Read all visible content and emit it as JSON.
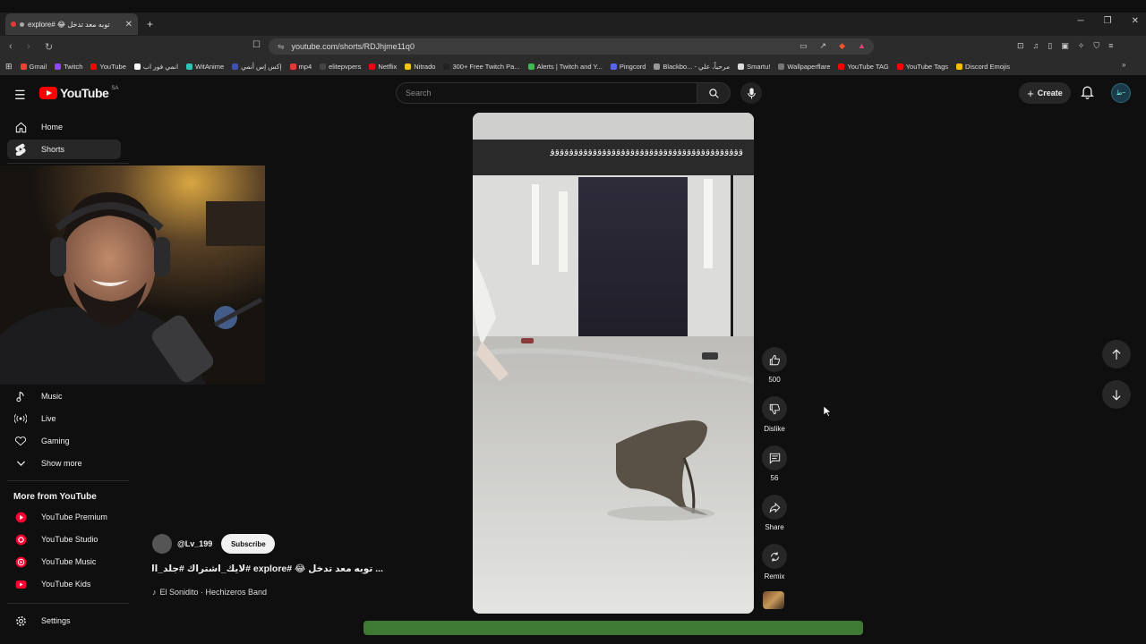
{
  "browser": {
    "tab_title": "explore# 😂 توبه معد تدخل",
    "url": "youtube.com/shorts/RDJhjme11q0",
    "bookmarks": [
      "Gmail",
      "Twitch",
      "YouTube",
      "انمي فور اب",
      "WitAnime",
      "إكس إس أنمي",
      "mp4",
      "elitepvpers",
      "Netflix",
      "Nitrado",
      "300+ Free Twitch Pa...",
      "Alerts | Twitch and Y...",
      "Pingcord",
      "Blackbo... - مرحباً، علي",
      "Smartu!",
      "Wallpaperflare",
      "YouTube TAG",
      "YouTube Tags",
      "Discord Emojis"
    ],
    "bookmark_colors": [
      "#ea4335",
      "#9146ff",
      "#ff0000",
      "#ffffff",
      "#2ec4b6",
      "#3f51b5",
      "#e53935",
      "#444444",
      "#e50914",
      "#f5c518",
      "#222222",
      "#3fb950",
      "#5865f2",
      "#999999",
      "#dddddd",
      "#777777",
      "#ff0000",
      "#ff0000",
      "#fbbc05"
    ]
  },
  "header": {
    "logo_text": "YouTube",
    "country_code": "SA",
    "search_placeholder": "Search",
    "create_label": "Create",
    "avatar_text": "ط~"
  },
  "sidebar": {
    "top_items": [
      {
        "label": "Home",
        "icon": "home-icon"
      },
      {
        "label": "Shorts",
        "icon": "shorts-icon",
        "active": true
      }
    ],
    "explore_items": [
      {
        "label": "Music",
        "icon": "music-note-icon"
      },
      {
        "label": "Live",
        "icon": "live-icon"
      },
      {
        "label": "Gaming",
        "icon": "gaming-icon"
      },
      {
        "label": "Show more",
        "icon": "chevron-down-icon"
      }
    ],
    "more_heading": "More from YouTube",
    "more_items": [
      {
        "label": "YouTube Premium",
        "icon": "youtube-premium-icon"
      },
      {
        "label": "YouTube Studio",
        "icon": "youtube-studio-icon"
      },
      {
        "label": "YouTube Music",
        "icon": "youtube-music-icon"
      },
      {
        "label": "YouTube Kids",
        "icon": "youtube-kids-icon"
      }
    ],
    "settings_label": "Settings"
  },
  "short": {
    "channel": "@Lv_199",
    "subscribe_label": "Subscribe",
    "title": "... توبه معد تدخل 😂 #explore #لايك_اشتراك #جلد_الدعم",
    "song": "El Sonidito · Hechizeros Band",
    "like_count": "500",
    "dislike_label": "Dislike",
    "comment_count": "56",
    "share_label": "Share",
    "remix_label": "Remix",
    "overlay_text": "ﻗﻗﻗﻗﻗﻗﻗﻗﻗﻗﻗﻗﻗﻗﻗﻗﻗﻗﻗﻗﻗﻗﻗﻗﻗﻗﻗﻗﻗﻗﻗﻗﻗﻗﻗﻗﻗﻗﻗﻗﻗ"
  }
}
